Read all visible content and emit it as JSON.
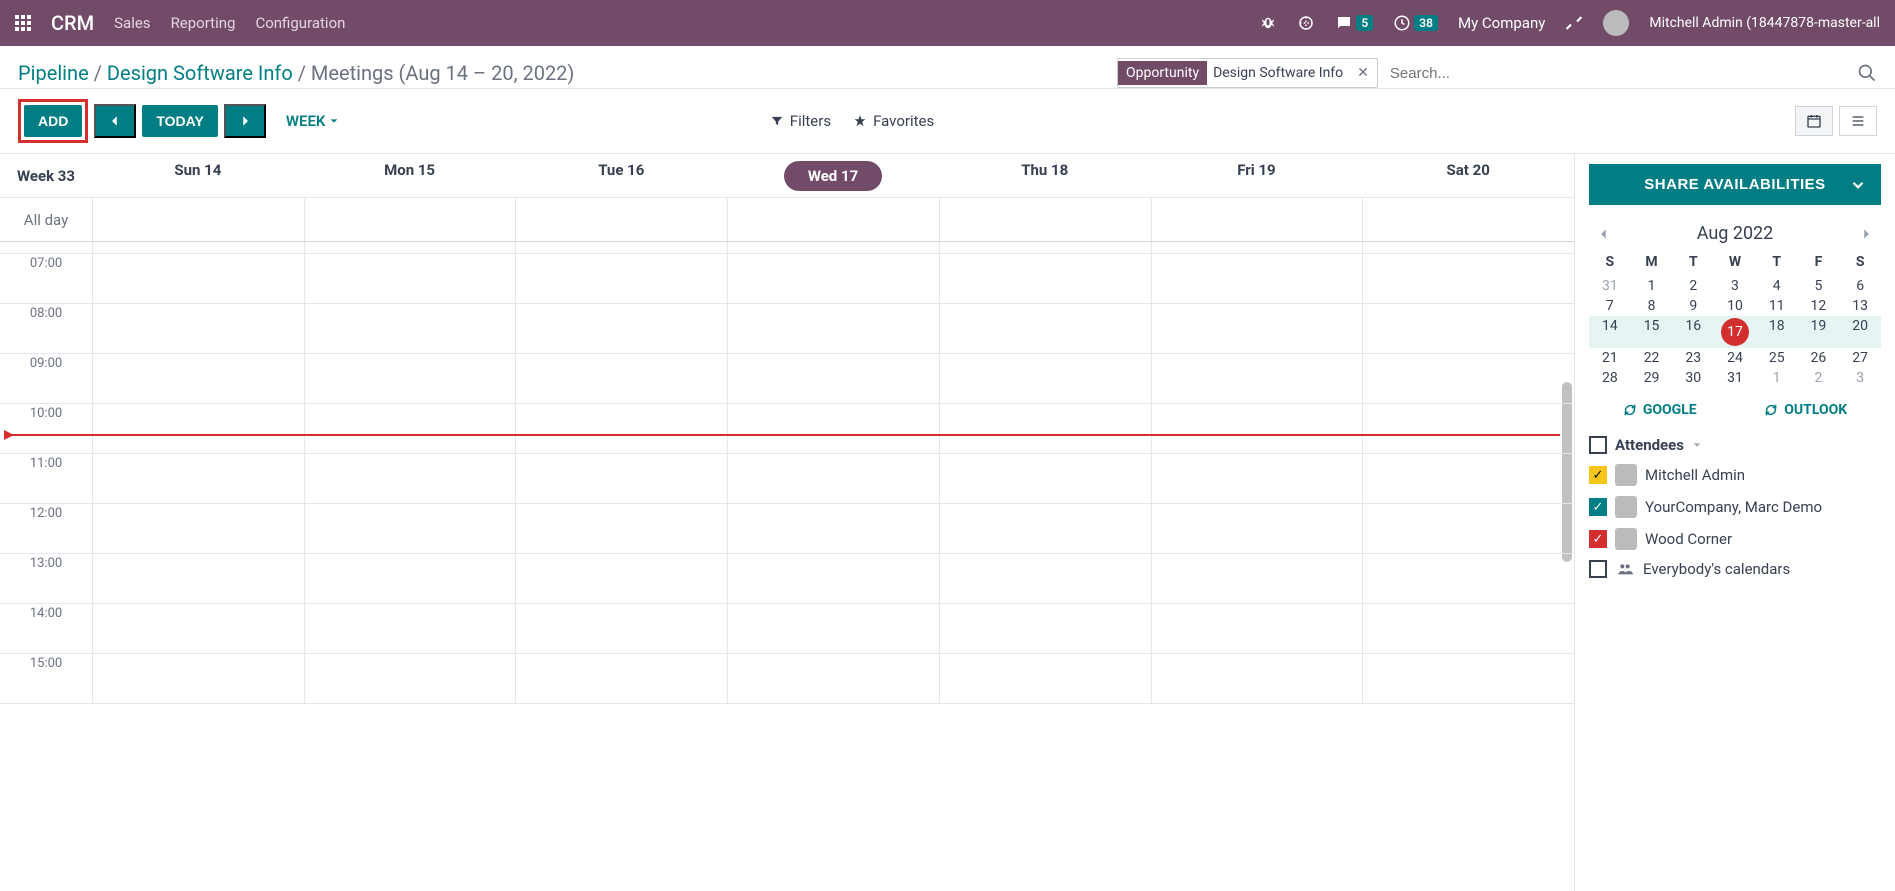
{
  "navbar": {
    "brand": "CRM",
    "menus": [
      "Sales",
      "Reporting",
      "Configuration"
    ],
    "msg_badge": "5",
    "activity_badge": "38",
    "company": "My Company",
    "user": "Mitchell Admin (18447878-master-all"
  },
  "breadcrumb": {
    "a": "Pipeline",
    "b": "Design Software Info",
    "c": "Meetings (Aug 14 – 20, 2022)"
  },
  "search": {
    "pill_label": "Opportunity",
    "pill_value": "Design Software Info",
    "placeholder": "Search..."
  },
  "toolbar": {
    "add": "ADD",
    "today": "TODAY",
    "view": "WEEK",
    "filters": "Filters",
    "favorites": "Favorites"
  },
  "calendar": {
    "week_label": "Week 33",
    "days": [
      "Sun 14",
      "Mon 15",
      "Tue 16",
      "Wed 17",
      "Thu 18",
      "Fri 19",
      "Sat 20"
    ],
    "current_day_index": 3,
    "allday": "All day",
    "hours": [
      "07:00",
      "08:00",
      "09:00",
      "10:00",
      "11:00",
      "12:00",
      "13:00",
      "14:00",
      "15:00"
    ],
    "now_after_hour_index": 3
  },
  "side": {
    "share": "SHARE AVAILABILITIES",
    "month": "Aug 2022",
    "dow": [
      "S",
      "M",
      "T",
      "W",
      "T",
      "F",
      "S"
    ],
    "cells": [
      {
        "d": "31",
        "muted": true
      },
      {
        "d": "1"
      },
      {
        "d": "2"
      },
      {
        "d": "3"
      },
      {
        "d": "4"
      },
      {
        "d": "5"
      },
      {
        "d": "6"
      },
      {
        "d": "7"
      },
      {
        "d": "8"
      },
      {
        "d": "9"
      },
      {
        "d": "10"
      },
      {
        "d": "11"
      },
      {
        "d": "12"
      },
      {
        "d": "13"
      },
      {
        "d": "14",
        "hl": true
      },
      {
        "d": "15",
        "hl": true
      },
      {
        "d": "16",
        "hl": true
      },
      {
        "d": "17",
        "hl": true,
        "today": true
      },
      {
        "d": "18",
        "hl": true
      },
      {
        "d": "19",
        "hl": true
      },
      {
        "d": "20",
        "hl": true
      },
      {
        "d": "21"
      },
      {
        "d": "22"
      },
      {
        "d": "23"
      },
      {
        "d": "24"
      },
      {
        "d": "25"
      },
      {
        "d": "26"
      },
      {
        "d": "27"
      },
      {
        "d": "28"
      },
      {
        "d": "29"
      },
      {
        "d": "30"
      },
      {
        "d": "31"
      },
      {
        "d": "1",
        "muted": true
      },
      {
        "d": "2",
        "muted": true
      },
      {
        "d": "3",
        "muted": true
      }
    ],
    "google": "GOOGLE",
    "outlook": "OUTLOOK",
    "attendees_label": "Attendees",
    "attendees": [
      {
        "name": "Mitchell Admin",
        "cls": "yellow",
        "checked": true,
        "avatar": true
      },
      {
        "name": "YourCompany, Marc Demo",
        "cls": "teal",
        "checked": true,
        "avatar": true
      },
      {
        "name": "Wood Corner",
        "cls": "red",
        "checked": true,
        "avatar": true
      },
      {
        "name": "Everybody's calendars",
        "cls": "",
        "checked": false,
        "icon": true
      }
    ]
  }
}
